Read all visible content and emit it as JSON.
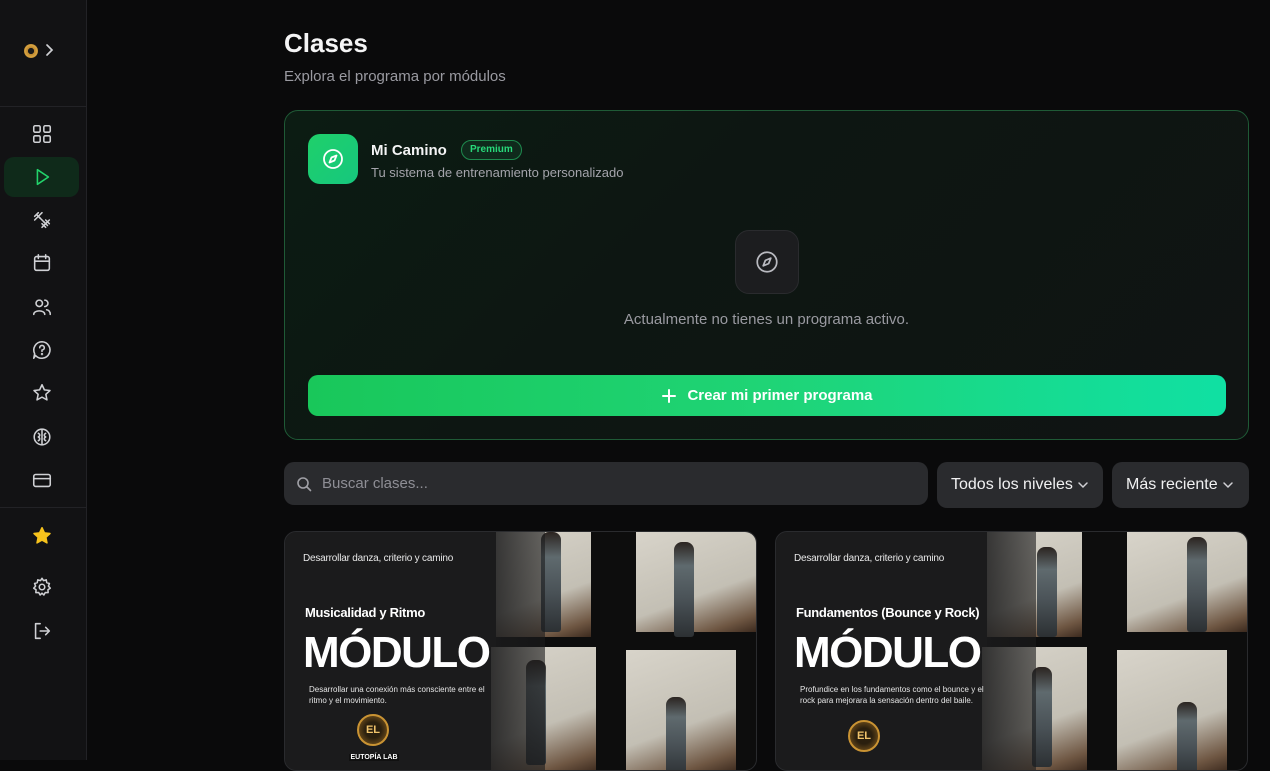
{
  "sidebar": {
    "nav": [
      {
        "name": "dashboard-icon",
        "active": false
      },
      {
        "name": "play-icon",
        "active": true
      },
      {
        "name": "puzzle-icon",
        "active": false
      },
      {
        "name": "calendar-icon",
        "active": false
      },
      {
        "name": "users-icon",
        "active": false
      },
      {
        "name": "help-chat-icon",
        "active": false
      },
      {
        "name": "star-icon",
        "active": false
      },
      {
        "name": "brain-icon",
        "active": false
      },
      {
        "name": "credit-card-icon",
        "active": false
      }
    ],
    "bottom": [
      "premium-star-icon",
      "settings-icon",
      "logout-icon"
    ]
  },
  "header": {
    "title": "Clases",
    "subtitle": "Explora el programa por módulos"
  },
  "program_card": {
    "title": "Mi Camino",
    "badge": "Premium",
    "subtitle": "Tu sistema de entrenamiento personalizado",
    "empty_message": "Actualmente no tienes un programa activo.",
    "cta_label": "Crear mi primer programa",
    "cta_icon": "plus-icon"
  },
  "filters": {
    "search_placeholder": "Buscar clases...",
    "level_select": "Todos los niveles",
    "sort_select": "Más reciente"
  },
  "modules": [
    {
      "kicker": "Desarrollar danza, criterio y camino",
      "name": "Musicalidad y Ritmo",
      "big_label": "MÓDULO",
      "description": "Desarrollar una conexión más consciente entre el ritmo y el movimiento.",
      "brand": "EUTOPÍA LAB"
    },
    {
      "kicker": "Desarrollar danza, criterio y camino",
      "name": "Fundamentos (Bounce y Rock)",
      "big_label": "MÓDULO",
      "description": "Profundice en los fundamentos como el bounce y el rock para mejorara la sensación dentro del baile."
    }
  ],
  "colors": {
    "accent": "#22d36b",
    "background": "#0a0a0b",
    "sidebar": "#121214",
    "card_border": "#1f5a36"
  }
}
